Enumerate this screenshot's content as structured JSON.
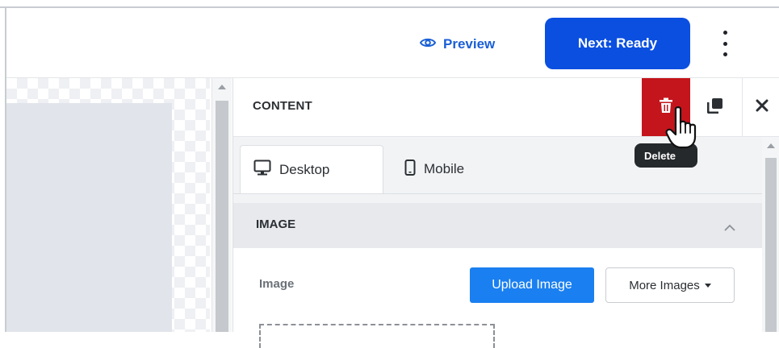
{
  "header": {
    "preview_label": "Preview",
    "next_label": "Next: Ready"
  },
  "panel": {
    "title": "CONTENT",
    "delete_tooltip": "Delete",
    "tabs": [
      {
        "label": "Desktop",
        "active": true,
        "icon": "monitor-icon"
      },
      {
        "label": "Mobile",
        "active": false,
        "icon": "phone-icon"
      }
    ],
    "section": {
      "title": "IMAGE",
      "expanded": true,
      "image_label": "Image",
      "upload_label": "Upload Image",
      "more_label": "More Images"
    }
  },
  "colors": {
    "primary": "#0b4fe0",
    "link": "#1a5fd6",
    "danger": "#c4151c",
    "upload": "#1a7ff0"
  }
}
